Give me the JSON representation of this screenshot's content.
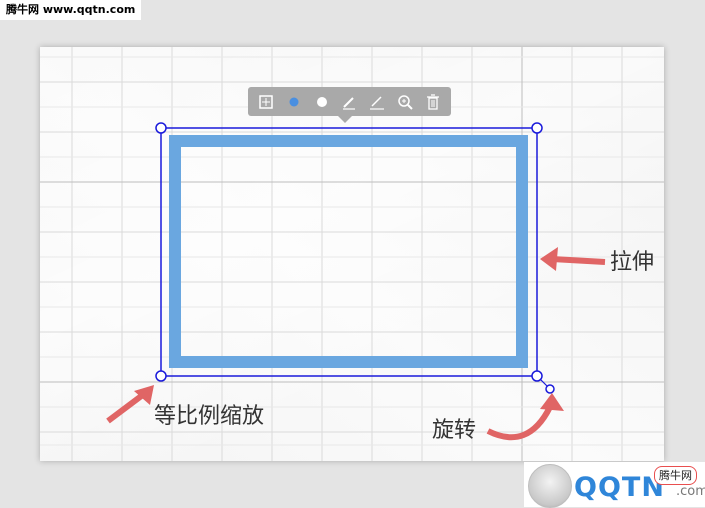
{
  "watermark_top": "腾牛网 www.qqtn.com",
  "annotations": {
    "stretch": "拉伸",
    "proportional_scale": "等比例缩放",
    "rotate": "旋转"
  },
  "toolbar": {
    "tools": [
      {
        "name": "crop-icon"
      },
      {
        "name": "color-dot-blue-icon"
      },
      {
        "name": "color-dot-white-icon"
      },
      {
        "name": "pen-icon"
      },
      {
        "name": "line-icon"
      },
      {
        "name": "zoom-in-icon"
      },
      {
        "name": "trash-icon"
      }
    ]
  },
  "colors": {
    "shape_stroke": "#6aa7e0",
    "selection": "#1a1adb",
    "arrow": "#e06565",
    "toolbar_bg": "#a9a9a9"
  },
  "logo": {
    "text": "QQTN",
    "suffix": ".com",
    "badge": "腾牛网"
  }
}
